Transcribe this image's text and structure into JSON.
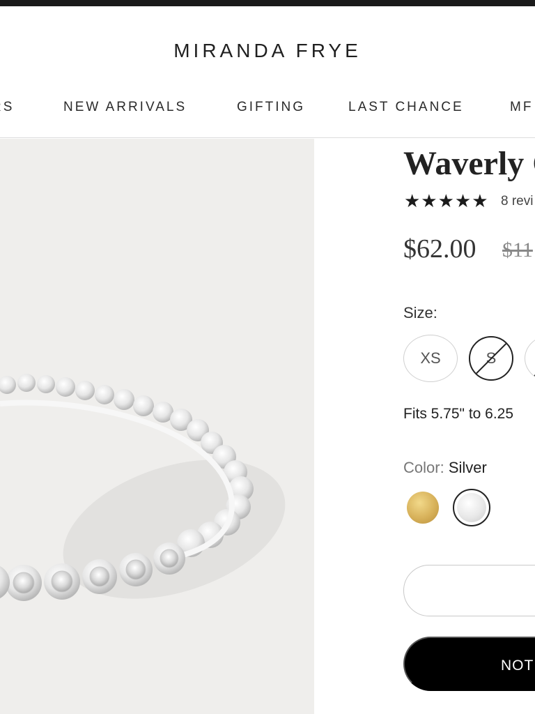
{
  "brand": {
    "name": "MIRANDA FRYE"
  },
  "nav": {
    "items": [
      {
        "label": "RS"
      },
      {
        "label": "NEW ARRIVALS"
      },
      {
        "label": "GIFTING"
      },
      {
        "label": "LAST CHANCE"
      },
      {
        "label": "MF"
      }
    ]
  },
  "product": {
    "title": "Waverly C",
    "rating": {
      "stars": "★★★★★",
      "value": 5,
      "reviews_text": "8 revi"
    },
    "price": "$62.00",
    "compare_price": "$11",
    "size": {
      "label": "Size:",
      "options": [
        {
          "label": "XS",
          "available": true
        },
        {
          "label": "S",
          "available": false,
          "selected": true
        },
        {
          "label": "",
          "available": false
        }
      ]
    },
    "fit_text": "Fits 5.75\" to 6.25",
    "color": {
      "label": "Color:",
      "selected": "Silver",
      "swatches": [
        {
          "name": "Gold",
          "color": "#d7b15a"
        },
        {
          "name": "Silver",
          "color": "#e8e8e8"
        }
      ]
    },
    "notify_label": "NOTI"
  },
  "colors": {
    "accent": "#000000",
    "image_background": "#efeeec",
    "topbar": "#1a1a1a"
  },
  "icons": {
    "rating": "star-icon",
    "unavailable": "slash-icon"
  }
}
